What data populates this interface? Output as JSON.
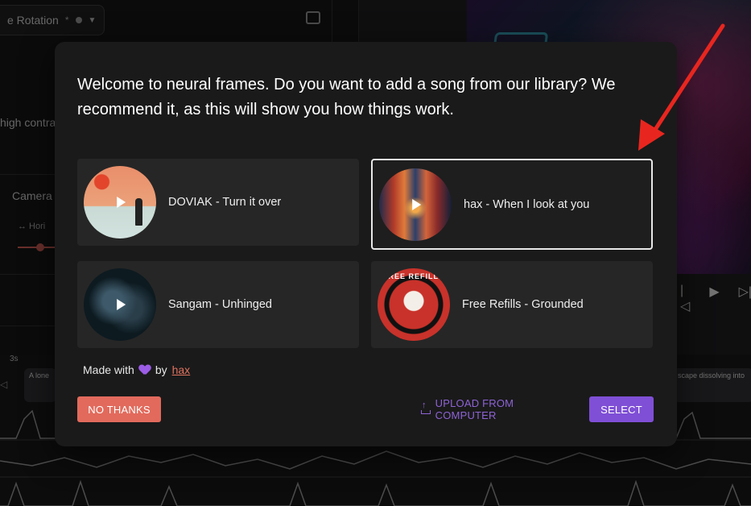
{
  "background": {
    "topbar_label": "e Rotation",
    "topbar_star": "*",
    "side_text_contrast": "high contra",
    "side_text_camera": "Camera",
    "side_text_hori": "↔  Hori",
    "timeline_label": "3s",
    "clip_left_text": "A lone",
    "clip_right_text": "scape dissolving into",
    "player_controls": [
      "|◁",
      "▶",
      "▷|"
    ]
  },
  "modal": {
    "title": "Welcome to neural frames. Do you want to add a song from our library? We recommend it, as this will show you how things work.",
    "songs": [
      {
        "label": "DOVIAK - Turn it over",
        "selected": false
      },
      {
        "label": "hax - When I look at you",
        "selected": true
      },
      {
        "label": "Sangam - Unhinged",
        "selected": false
      },
      {
        "label": "Free Refills - Grounded",
        "selected": false
      }
    ],
    "free_refills_art_text": "FREE REFILLS",
    "made_with_prefix": "Made with",
    "made_with_by": "by",
    "made_with_link": "hax",
    "buttons": {
      "no_thanks": "NO THANKS",
      "upload": "UPLOAD FROM COMPUTER",
      "select": "SELECT"
    }
  },
  "colors": {
    "accent_purple": "#7f4fd6",
    "no_thanks_red": "#e26a5c",
    "arrow_red": "#e8261f",
    "modal_bg": "#1a1a1a",
    "card_bg": "#262626"
  }
}
